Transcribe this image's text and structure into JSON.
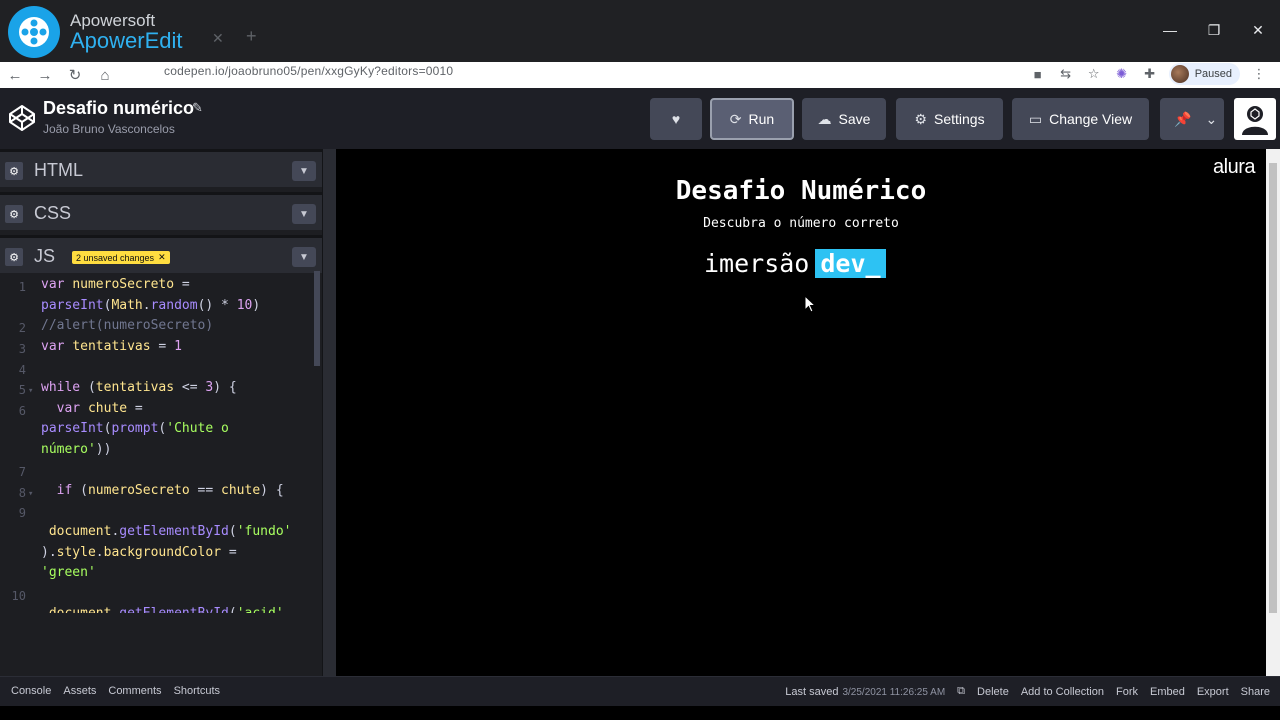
{
  "watermark": {
    "line1": "Apowersoft",
    "line2": "ApowerEdit"
  },
  "browser": {
    "url": "codepen.io/joaobruno05/pen/xxgGyKy?editors=0010",
    "profile_status": "Paused"
  },
  "codepen": {
    "pen_title": "Desafio numérico",
    "author": "João Bruno Vasconcelos",
    "buttons": {
      "run": "Run",
      "save": "Save",
      "settings": "Settings",
      "change_view": "Change View"
    }
  },
  "editor": {
    "panels": {
      "html": "HTML",
      "css": "CSS",
      "js": "JS"
    },
    "unsaved_badge": "2 unsaved changes",
    "line_numbers": [
      "1",
      "2",
      "3",
      "4",
      "5",
      "6",
      "7",
      "8",
      "9",
      "10"
    ]
  },
  "preview": {
    "title": "Desafio Numérico",
    "subtitle": "Descubra o número correto",
    "brand_part1": "imersão",
    "brand_part2": "dev_",
    "logo_text": "alura"
  },
  "footer": {
    "left": [
      "Console",
      "Assets",
      "Comments",
      "Shortcuts"
    ],
    "last_saved_label": "Last saved",
    "last_saved_date": "3/25/2021 11:26:25 AM",
    "right": [
      "Delete",
      "Add to Collection",
      "Fork",
      "Embed",
      "Export",
      "Share"
    ]
  },
  "colors": {
    "accent_dev": "#2dc2f3",
    "unsaved_badge": "#ffdd40",
    "editor_bg": "#1d1e22"
  }
}
